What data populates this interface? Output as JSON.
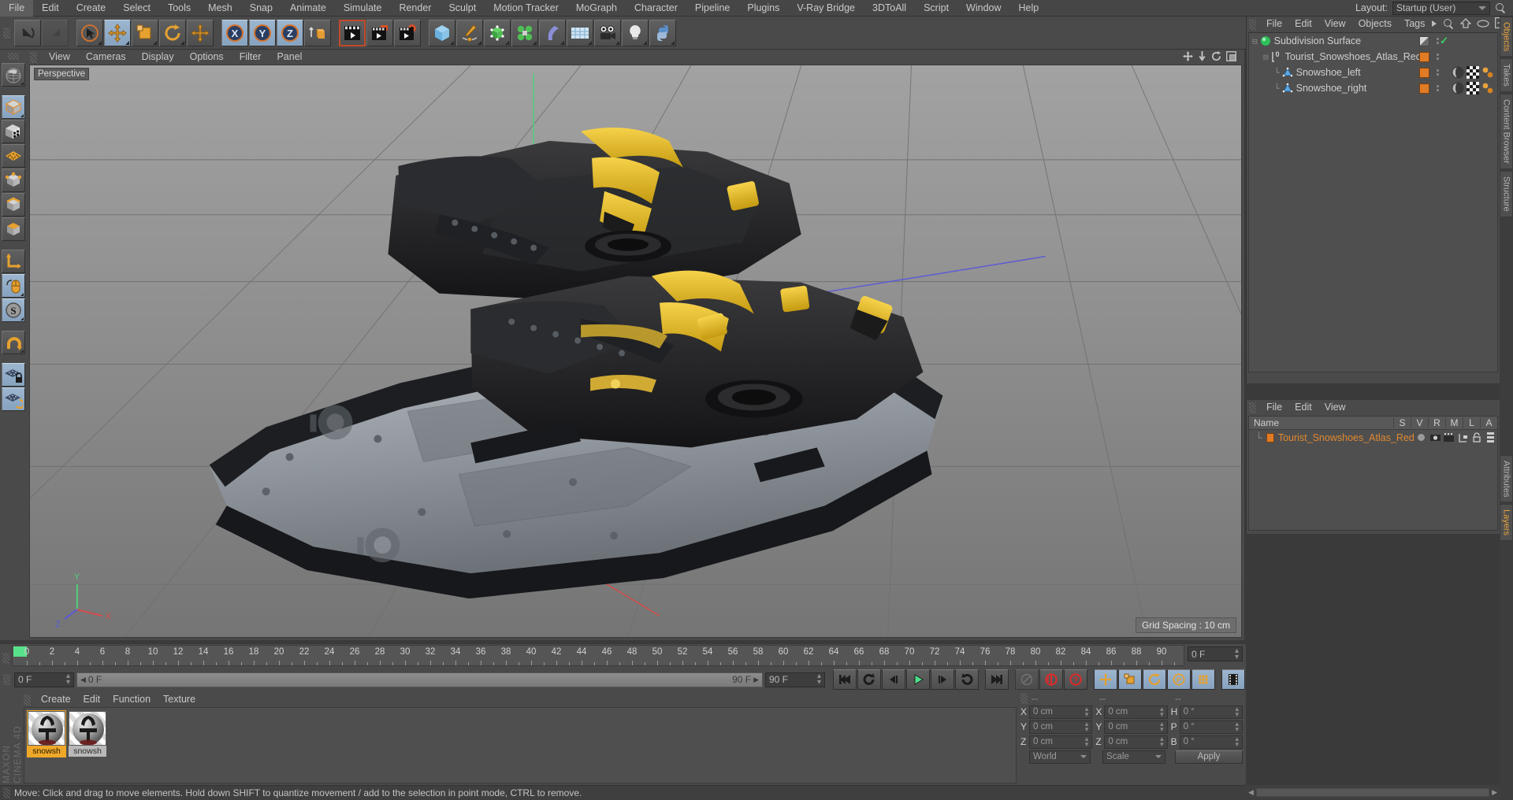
{
  "app": {
    "name": "CINEMA 4D",
    "brand_left": "MAXON CINEMA 4D"
  },
  "menubar": {
    "items": [
      "File",
      "Edit",
      "Create",
      "Select",
      "Tools",
      "Mesh",
      "Snap",
      "Animate",
      "Simulate",
      "Render",
      "Sculpt",
      "Motion Tracker",
      "MoGraph",
      "Character",
      "Pipeline",
      "Plugins",
      "V-Ray Bridge",
      "3DToAll",
      "Script",
      "Window",
      "Help"
    ],
    "layout_label": "Layout:",
    "layout_value": "Startup (User)",
    "search_icon": "search-icon"
  },
  "toolbar": {
    "groups": [
      {
        "buttons": [
          {
            "name": "undo-button",
            "icon": "undo-arrow",
            "selected": false
          },
          {
            "name": "redo-button",
            "icon": "redo-arrow",
            "selected": false
          }
        ]
      },
      {
        "buttons": [
          {
            "name": "live-selection-tool",
            "icon": "cursor-circle",
            "selected": false
          },
          {
            "name": "move-tool",
            "icon": "move-cross",
            "selected": true
          },
          {
            "name": "scale-tool",
            "icon": "scale-box",
            "selected": false
          },
          {
            "name": "rotate-tool",
            "icon": "rotate-circle",
            "selected": false
          },
          {
            "name": "move-dup-tool",
            "icon": "move-cross",
            "selected": false
          }
        ]
      },
      {
        "buttons": [
          {
            "name": "x-axis-lock",
            "icon": "axis-x",
            "selected": true
          },
          {
            "name": "y-axis-lock",
            "icon": "axis-y",
            "selected": true
          },
          {
            "name": "z-axis-lock",
            "icon": "axis-z",
            "selected": true
          },
          {
            "name": "world-object-coord",
            "icon": "world-coord-cube",
            "selected": false
          }
        ]
      },
      {
        "buttons": [
          {
            "name": "render-view-button",
            "icon": "clapper-render",
            "selected": false
          },
          {
            "name": "render-to-picture-viewer-button",
            "icon": "clapper-picture",
            "selected": false
          },
          {
            "name": "render-settings-button",
            "icon": "clapper-gear",
            "selected": false
          }
        ]
      },
      {
        "buttons": [
          {
            "name": "add-cube-button",
            "icon": "cube-blue",
            "selected": false
          },
          {
            "name": "add-spline-button",
            "icon": "pen-spline",
            "selected": false
          },
          {
            "name": "add-nurbs-button",
            "icon": "green-cube-nurbs",
            "selected": false
          },
          {
            "name": "add-array-button",
            "icon": "green-cluster",
            "selected": false
          },
          {
            "name": "add-deformer-button",
            "icon": "bend-deformer",
            "selected": false
          },
          {
            "name": "add-scene-button",
            "icon": "floor-grid",
            "selected": false
          },
          {
            "name": "add-camera-button",
            "icon": "camera",
            "selected": false
          },
          {
            "name": "add-light-button",
            "icon": "light-bulb",
            "selected": false
          },
          {
            "name": "python-script-button",
            "icon": "python",
            "selected": false
          }
        ]
      }
    ]
  },
  "left_toolbar": {
    "buttons": [
      {
        "name": "viewport-navigation-tool",
        "icon": "globe-wire",
        "selected": false
      },
      {
        "name": "model-mode",
        "icon": "cube-orange-outline",
        "selected": true
      },
      {
        "name": "texture-mode",
        "icon": "checker-cube",
        "selected": false
      },
      {
        "name": "polygon-mode",
        "icon": "polygon-grid",
        "selected": false
      },
      {
        "name": "point-mode",
        "icon": "point-cube",
        "selected": false
      },
      {
        "name": "edge-mode",
        "icon": "edge-cube",
        "selected": false
      },
      {
        "name": "object-axis-mode",
        "icon": "axis-cube",
        "selected": false
      },
      {
        "name": "enable-axis-mode",
        "icon": "axis-l-arrow",
        "selected": false
      },
      {
        "name": "viewport-solo-mode",
        "icon": "mouse-tool",
        "selected": true
      },
      {
        "name": "snap-toggle",
        "icon": "snap-s",
        "selected": true
      },
      {
        "name": "magnet-tool",
        "icon": "magnet",
        "selected": false
      },
      {
        "name": "lock-workplane",
        "icon": "grid-lock",
        "selected": true
      },
      {
        "name": "workplane-tool",
        "icon": "grid-tool",
        "selected": true
      }
    ]
  },
  "viewport": {
    "menus": [
      "View",
      "Cameras",
      "Display",
      "Options",
      "Filter",
      "Panel"
    ],
    "label": "Perspective",
    "grid_spacing": "Grid Spacing : 10 cm",
    "corner_icons": [
      "pan-icon",
      "dolly-icon",
      "rotate-icon",
      "maximize-icon"
    ],
    "axis_labels": {
      "y": "Y",
      "x": "X",
      "z": "Z"
    },
    "bg_color": "#8a8a8a",
    "scene_description": "Pair of dark grey and yellow tourist snowshoes, 3D model"
  },
  "object_manager": {
    "menus": [
      "File",
      "Edit",
      "View",
      "Objects",
      "Tags"
    ],
    "header_icons": [
      "more-arrow-icon",
      "search-icon",
      "home-icon",
      "eye-icon",
      "plus-icon"
    ],
    "rows": [
      {
        "name": "Subdivision Surface",
        "indent": 0,
        "icon": "subdivision-surface-icon",
        "color_box": "grey",
        "check": true
      },
      {
        "name": "Tourist_Snowshoes_Atlas_Red",
        "indent": 1,
        "icon": "null-object-icon",
        "color_box": "orange",
        "check": false
      },
      {
        "name": "Snowshoe_left",
        "indent": 2,
        "icon": "polygon-object-icon",
        "color_box": "orange",
        "check": false,
        "tags": [
          "texture-tag",
          "uv-tag",
          "material-tag"
        ]
      },
      {
        "name": "Snowshoe_right",
        "indent": 2,
        "icon": "polygon-object-icon",
        "color_box": "orange",
        "check": false,
        "tags": [
          "texture-tag",
          "uv-tag",
          "material-tag"
        ]
      }
    ]
  },
  "layer_manager": {
    "menus": [
      "File",
      "Edit",
      "View"
    ],
    "columns": [
      "Name",
      "S",
      "V",
      "R",
      "M",
      "L",
      "A"
    ],
    "rows": [
      {
        "name": "Tourist_Snowshoes_Atlas_Red",
        "color": "#e07b26"
      }
    ]
  },
  "vertical_tabs": {
    "top": [
      {
        "label": "Objects",
        "active": true
      },
      {
        "label": "Takes",
        "active": false
      },
      {
        "label": "Content Browser",
        "active": false
      },
      {
        "label": "Structure",
        "active": false
      }
    ],
    "bottom": [
      {
        "label": "Attributes",
        "active": false
      },
      {
        "label": "Layers",
        "active": true
      }
    ]
  },
  "timeline": {
    "start": 0,
    "end": 90,
    "tick_labels": [
      0,
      2,
      4,
      6,
      8,
      10,
      12,
      14,
      16,
      18,
      20,
      22,
      24,
      26,
      28,
      30,
      32,
      34,
      36,
      38,
      40,
      42,
      44,
      46,
      48,
      50,
      52,
      54,
      56,
      58,
      60,
      62,
      64,
      66,
      68,
      70,
      72,
      74,
      76,
      78,
      80,
      82,
      84,
      86,
      88,
      90
    ],
    "right_field": "0 F"
  },
  "transport": {
    "current_frame_field": "0 F",
    "range_start_label": "0 F",
    "range_end_label": "90 F",
    "end_frame_field": "90 F",
    "buttons": [
      {
        "name": "go-to-start-button",
        "icon": "skip-back-icon"
      },
      {
        "name": "previous-keyframe-button",
        "icon": "rewind-key-icon"
      },
      {
        "name": "step-back-button",
        "icon": "step-back-icon"
      },
      {
        "name": "play-button",
        "icon": "play-icon"
      },
      {
        "name": "step-forward-button",
        "icon": "step-forward-icon"
      },
      {
        "name": "next-keyframe-button",
        "icon": "forward-key-icon"
      },
      {
        "name": "go-to-end-button",
        "icon": "skip-forward-icon"
      },
      {
        "name": "record-active-objects-button",
        "icon": "key-disabled-icon"
      },
      {
        "name": "autokeying-button",
        "icon": "record-circle-icon"
      },
      {
        "name": "keyframe-selection-button",
        "icon": "question-circle-icon"
      },
      {
        "name": "position-key-button",
        "icon": "move-key-icon"
      },
      {
        "name": "scale-key-button",
        "icon": "scale-key-icon"
      },
      {
        "name": "rotation-key-button",
        "icon": "rotate-key-icon"
      },
      {
        "name": "parameter-key-button",
        "icon": "param-p-icon"
      },
      {
        "name": "point-level-animation-button",
        "icon": "pla-dots-icon"
      },
      {
        "name": "timeline-mode-button",
        "icon": "filmstrip-icon"
      }
    ]
  },
  "material_manager": {
    "menus": [
      "Create",
      "Edit",
      "Function",
      "Texture"
    ],
    "materials": [
      {
        "label": "snowsh",
        "selected": true
      },
      {
        "label": "snowsh",
        "selected": false
      }
    ]
  },
  "coordinates": {
    "header": [
      "--",
      "--",
      "--"
    ],
    "position": {
      "label_x": "X",
      "label_y": "Y",
      "label_z": "Z",
      "x": "0 cm",
      "y": "0 cm",
      "z": "0 cm"
    },
    "size": {
      "label_x": "X",
      "label_y": "Y",
      "label_z": "Z",
      "x": "0 cm",
      "y": "0 cm",
      "z": "0 cm"
    },
    "rotation": {
      "label_h": "H",
      "label_p": "P",
      "label_b": "B",
      "h": "0 °",
      "p": "0 °",
      "b": "0 °"
    },
    "coord_system": "World",
    "mode": "Scale",
    "apply_label": "Apply"
  },
  "status_bar": {
    "message": "Move: Click and drag to move elements. Hold down SHIFT to quantize movement / add to the selection in point mode, CTRL to remove."
  },
  "colors": {
    "accent_orange": "#e07b26",
    "selection_blue": "#8fa9c6",
    "panel_bg": "#4a4a4a",
    "viewport_bg": "#8a8a8a",
    "highlight_green": "#3fd06a"
  }
}
